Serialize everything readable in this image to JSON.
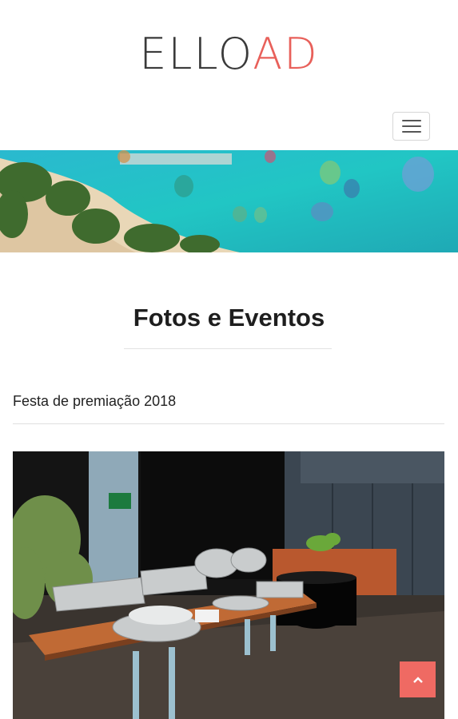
{
  "header": {
    "logo_dark": "ELLO",
    "logo_accent": "AD",
    "menu_icon": "hamburger-icon"
  },
  "main": {
    "section_title": "Fotos e Eventos",
    "event_title": "Festa de premiação 2018"
  },
  "scroll_top_icon": "chevron-up-icon",
  "colors": {
    "accent": "#ef6a63",
    "logo_accent": "#e8605a",
    "logo_dark": "#3a3a3a",
    "text": "#1e1e1e"
  }
}
